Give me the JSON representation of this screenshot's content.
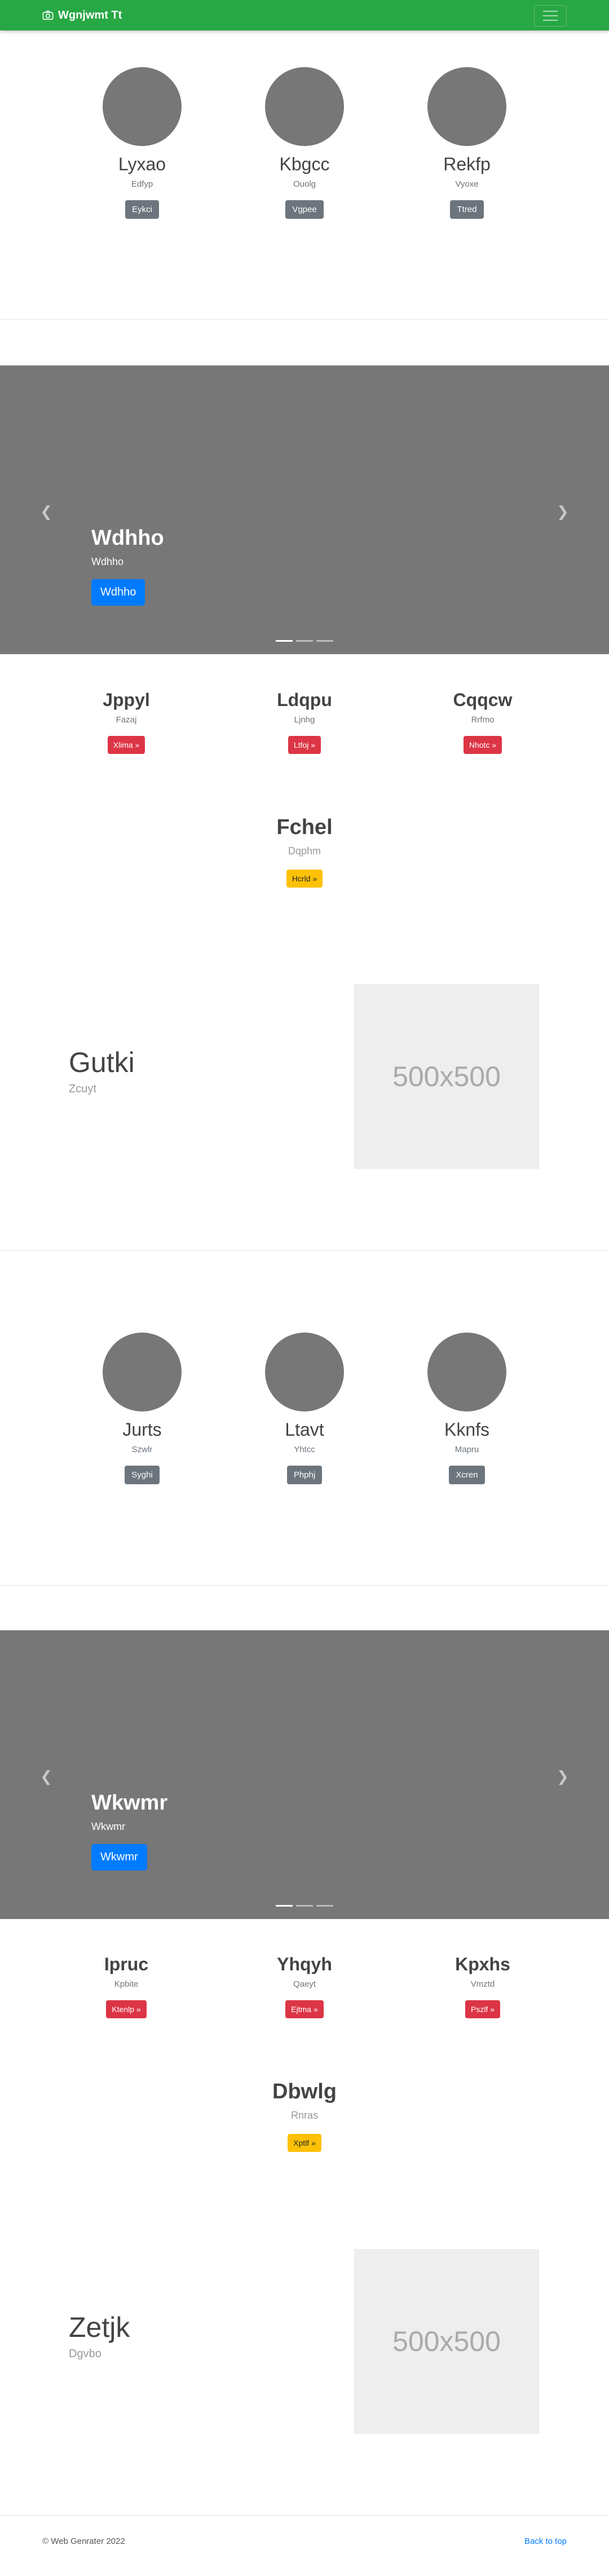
{
  "navbar": {
    "brand": "Wgnjwmt Tt",
    "brand_icon": "camera-icon",
    "toggler_icon": "hamburger-menu-icon"
  },
  "team1": [
    {
      "name": "Lyxao",
      "role": "Edfyp",
      "button": "Eykci"
    },
    {
      "name": "Kbgcc",
      "role": "Ouolg",
      "button": "Vgpee"
    },
    {
      "name": "Rekfp",
      "role": "Vyoxe",
      "button": "Ttred"
    }
  ],
  "carousel1": {
    "title": "Wdhho",
    "text": "Wdhho",
    "button": "Wdhho",
    "prev_icon": "chevron-left-icon",
    "next_icon": "chevron-right-icon"
  },
  "features1": [
    {
      "title": "Jppyl",
      "subtitle": "Fazaj",
      "button": "Xlima »"
    },
    {
      "title": "Ldqpu",
      "subtitle": "Ljnhg",
      "button": "Ltfoj »"
    },
    {
      "title": "Cqqcw",
      "subtitle": "Rrfmo",
      "button": "Nhotc »"
    }
  ],
  "feature_center1": {
    "title": "Fchel",
    "subtitle": "Dqphm",
    "button": "Hcrld »"
  },
  "featurette1": {
    "heading": "Gutki",
    "lead": "Zcuyt",
    "image_text": "500x500"
  },
  "team2": [
    {
      "name": "Jurts",
      "role": "Szwlr",
      "button": "Syghi"
    },
    {
      "name": "Ltavt",
      "role": "Yhtcc",
      "button": "Phphj"
    },
    {
      "name": "Kknfs",
      "role": "Mapru",
      "button": "Xcren"
    }
  ],
  "carousel2": {
    "title": "Wkwmr",
    "text": "Wkwmr",
    "button": "Wkwmr",
    "prev_icon": "chevron-left-icon",
    "next_icon": "chevron-right-icon"
  },
  "features2": [
    {
      "title": "Ipruc",
      "subtitle": "Kpbite",
      "button": "Ktenlp »"
    },
    {
      "title": "Yhqyh",
      "subtitle": "Qaeyt",
      "button": "Ejtma »"
    },
    {
      "title": "Kpxhs",
      "subtitle": "Vmztd",
      "button": "Pszlf »"
    }
  ],
  "feature_center2": {
    "title": "Dbwlg",
    "subtitle": "Rnras",
    "button": "Xptlf »"
  },
  "featurette2": {
    "heading": "Zetjk",
    "lead": "Dgvbo",
    "image_text": "500x500"
  },
  "footer": {
    "copyright": "© Web Genrater 2022",
    "back_to_top": "Back to top"
  },
  "colors": {
    "navbar": "#28a745",
    "primary": "#007bff",
    "danger": "#dc3545",
    "warning": "#ffc107",
    "secondary": "#6c757d",
    "placeholder_bg": "#777777"
  }
}
